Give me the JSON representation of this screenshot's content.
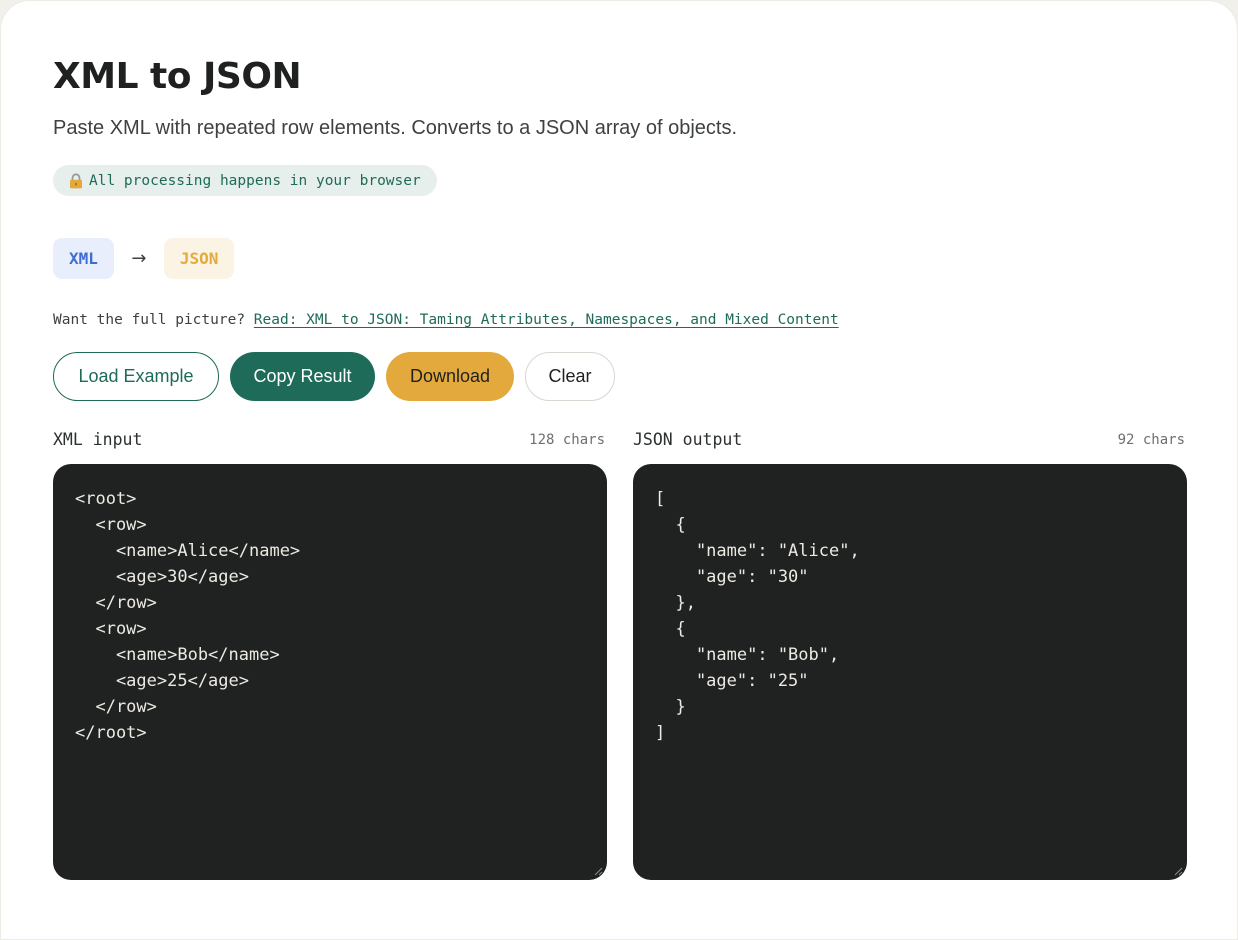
{
  "header": {
    "title": "XML to JSON",
    "subtitle": "Paste XML with repeated row elements. Converts to a JSON array of objects.",
    "privacy_note": "All processing happens in your browser",
    "privacy_icon": "lock-icon"
  },
  "formats": {
    "from": "XML",
    "arrow": "→",
    "to": "JSON"
  },
  "readmore": {
    "prefix": "Want the full picture?",
    "link_text": "Read: XML to JSON: Taming Attributes, Namespaces, and Mixed Content"
  },
  "actions": {
    "load_example": "Load Example",
    "copy_result": "Copy Result",
    "download": "Download",
    "clear": "Clear"
  },
  "input": {
    "label": "XML input",
    "count": "128 chars",
    "value": "<root>\n  <row>\n    <name>Alice</name>\n    <age>30</age>\n  </row>\n  <row>\n    <name>Bob</name>\n    <age>25</age>\n  </row>\n</root>"
  },
  "output": {
    "label": "JSON output",
    "count": "92 chars",
    "value": "[\n  {\n    \"name\": \"Alice\",\n    \"age\": \"30\"\n  },\n  {\n    \"name\": \"Bob\",\n    \"age\": \"25\"\n  }\n]"
  },
  "colors": {
    "brand": "#1e6b5a",
    "accent": "#e3a93c",
    "xml_badge": "#3e6ed4",
    "json_badge": "#e3ab3c",
    "editor_bg": "#1f2221"
  }
}
